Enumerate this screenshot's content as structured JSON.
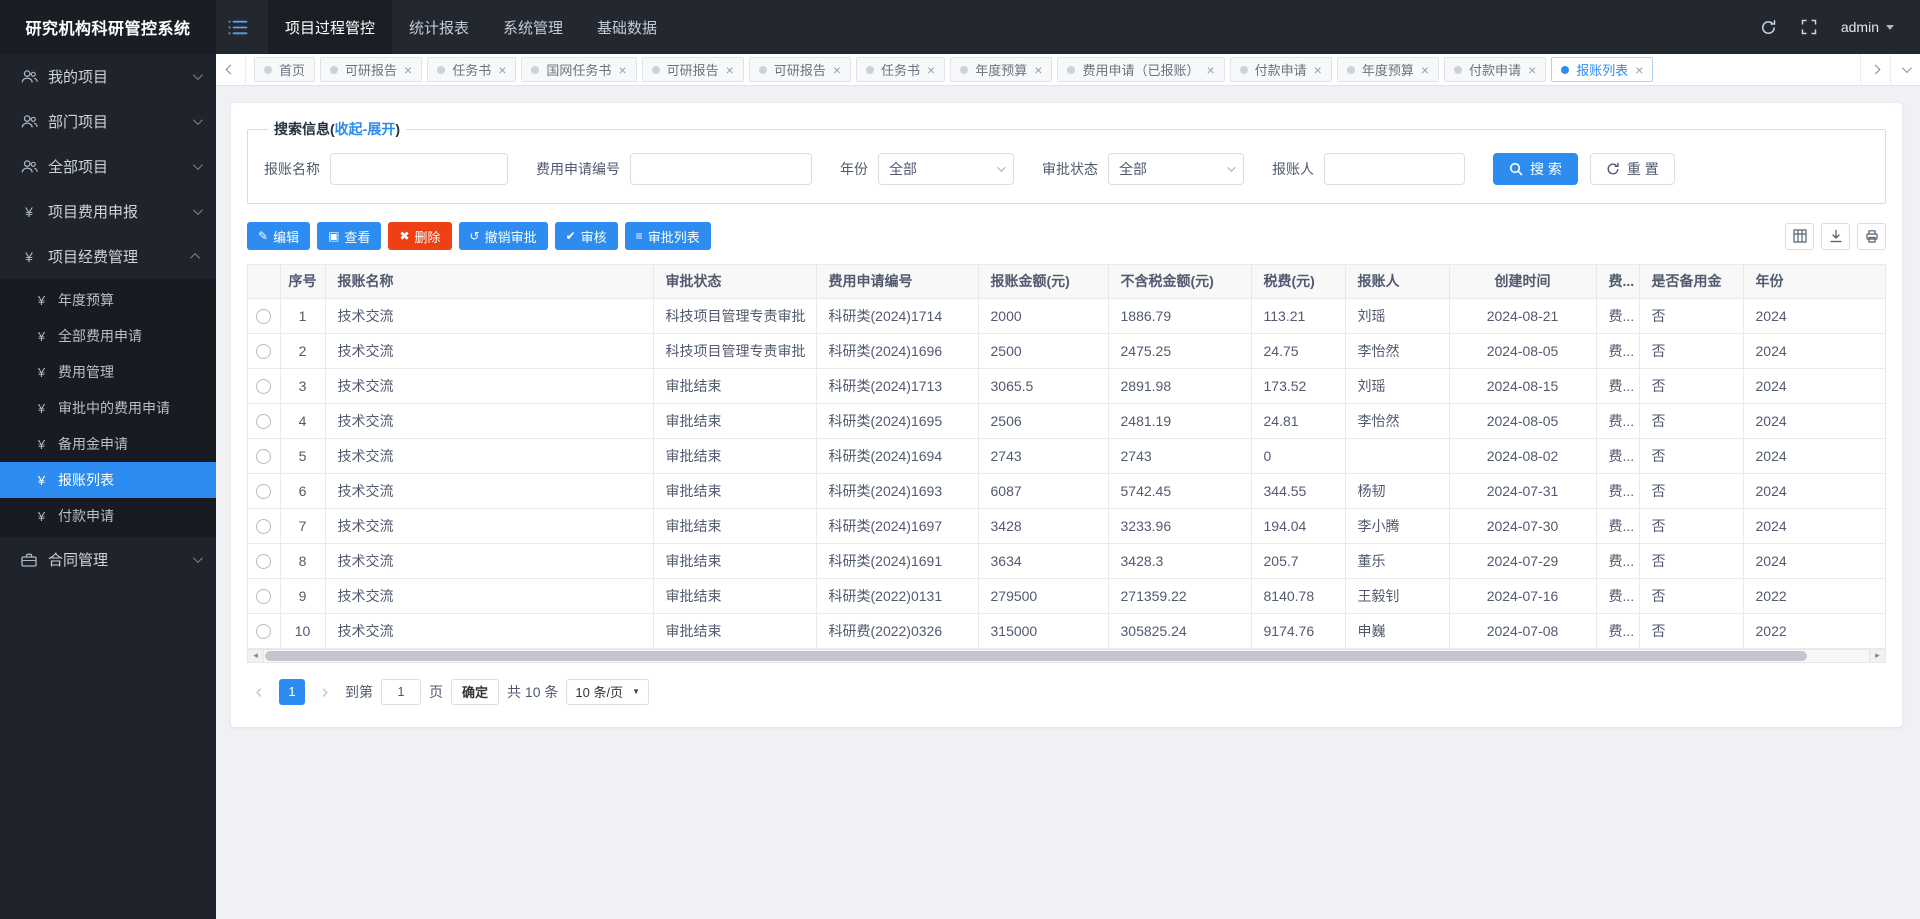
{
  "app_title": "研究机构科研管控系统",
  "accent_color": "#2d8cf0",
  "danger_color": "#ed4014",
  "header": {
    "nav_items": [
      {
        "label": "项目过程管控",
        "active": true,
        "name": "nav-project-process"
      },
      {
        "label": "统计报表",
        "name": "nav-statistics"
      },
      {
        "label": "系统管理",
        "name": "nav-system-mgmt"
      },
      {
        "label": "基础数据",
        "name": "nav-base-data"
      }
    ],
    "user_name": "admin"
  },
  "tag_nav": {
    "tabs": [
      {
        "label": "首页"
      },
      {
        "label": "可研报告",
        "closable": true
      },
      {
        "label": "任务书",
        "closable": true
      },
      {
        "label": "国网任务书",
        "closable": true
      },
      {
        "label": "可研报告",
        "closable": true
      },
      {
        "label": "可研报告",
        "closable": true
      },
      {
        "label": "任务书",
        "closable": true
      },
      {
        "label": "年度预算",
        "closable": true
      },
      {
        "label": "费用申请（已报账）",
        "closable": true
      },
      {
        "label": "付款申请",
        "closable": true
      },
      {
        "label": "年度预算",
        "closable": true
      },
      {
        "label": "付款申请",
        "closable": true
      },
      {
        "label": "报账列表",
        "closable": true,
        "active": true
      }
    ]
  },
  "sidebar": {
    "items": [
      {
        "label": "我的项目"
      },
      {
        "label": "部门项目"
      },
      {
        "label": "全部项目"
      },
      {
        "label": "项目费用申报"
      },
      {
        "label": "项目经费管理"
      },
      {
        "label": "合同管理"
      }
    ],
    "submenu_items": [
      {
        "label": "年度预算",
        "name": "sidebar-subitem-annual-budget"
      },
      {
        "label": "全部费用申请",
        "name": "sidebar-subitem-all-expense-apply"
      },
      {
        "label": "费用管理",
        "name": "sidebar-subitem-expense-mgmt"
      },
      {
        "label": "审批中的费用申请",
        "name": "sidebar-subitem-approving-expense"
      },
      {
        "label": "备用金申请",
        "name": "sidebar-subitem-reserve-fund"
      },
      {
        "label": "报账列表",
        "active": true,
        "name": "sidebar-subitem-reimburse-list"
      },
      {
        "label": "付款申请",
        "name": "sidebar-subitem-payment-apply"
      }
    ]
  },
  "search": {
    "legend_prefix": "搜索信息(",
    "legend_link": "收起-展开",
    "legend_suffix": ")",
    "name_label": "报账名称",
    "apply_no_label": "费用申请编号",
    "year_label": "年份",
    "year_value": "全部",
    "status_label": "审批状态",
    "status_value": "全部",
    "person_label": "报账人",
    "search_button": "搜 索",
    "reset_button": "重 置"
  },
  "toolbar": {
    "buttons": [
      {
        "label": "编辑",
        "type": "primary",
        "glyph": "✎",
        "name": "edit-button"
      },
      {
        "label": "查看",
        "type": "primary",
        "glyph": "▣",
        "name": "view-button"
      },
      {
        "label": "删除",
        "type": "danger",
        "glyph": "✖",
        "name": "delete-button"
      },
      {
        "label": "撤销审批",
        "type": "primary",
        "glyph": "↺",
        "name": "revoke-approval-button"
      },
      {
        "label": "审核",
        "type": "primary",
        "glyph": "✔",
        "name": "review-button"
      },
      {
        "label": "审批列表",
        "type": "primary",
        "glyph": "≡",
        "name": "approval-list-button"
      }
    ]
  },
  "table": {
    "columns": [
      "序号",
      "报账名称",
      "审批状态",
      "费用申请编号",
      "报账金额(元)",
      "不含税金额(元)",
      "税费(元)",
      "报账人",
      "创建时间",
      "费...",
      "是否备用金",
      "年份"
    ],
    "rows": [
      {
        "seq": "1",
        "name": "技术交流",
        "status": "科技项目管理专责审批",
        "apply_no": "科研类(2024)1714",
        "amount": "2000",
        "no_tax": "1886.79",
        "tax": "113.21",
        "person": "刘瑶",
        "created": "2024-08-21",
        "fee": "费...",
        "reserve": "否",
        "year": "2024"
      },
      {
        "seq": "2",
        "name": "技术交流",
        "status": "科技项目管理专责审批",
        "apply_no": "科研类(2024)1696",
        "amount": "2500",
        "no_tax": "2475.25",
        "tax": "24.75",
        "person": "李怡然",
        "created": "2024-08-05",
        "fee": "费...",
        "reserve": "否",
        "year": "2024"
      },
      {
        "seq": "3",
        "name": "技术交流",
        "status": "审批结束",
        "apply_no": "科研类(2024)1713",
        "amount": "3065.5",
        "no_tax": "2891.98",
        "tax": "173.52",
        "person": "刘瑶",
        "created": "2024-08-15",
        "fee": "费...",
        "reserve": "否",
        "year": "2024"
      },
      {
        "seq": "4",
        "name": "技术交流",
        "status": "审批结束",
        "apply_no": "科研类(2024)1695",
        "amount": "2506",
        "no_tax": "2481.19",
        "tax": "24.81",
        "person": "李怡然",
        "created": "2024-08-05",
        "fee": "费...",
        "reserve": "否",
        "year": "2024"
      },
      {
        "seq": "5",
        "name": "技术交流",
        "status": "审批结束",
        "apply_no": "科研类(2024)1694",
        "amount": "2743",
        "no_tax": "2743",
        "tax": "0",
        "person": "",
        "created": "2024-08-02",
        "fee": "费...",
        "reserve": "否",
        "year": "2024"
      },
      {
        "seq": "6",
        "name": "技术交流",
        "status": "审批结束",
        "apply_no": "科研类(2024)1693",
        "amount": "6087",
        "no_tax": "5742.45",
        "tax": "344.55",
        "person": "杨韧",
        "created": "2024-07-31",
        "fee": "费...",
        "reserve": "否",
        "year": "2024"
      },
      {
        "seq": "7",
        "name": "技术交流",
        "status": "审批结束",
        "apply_no": "科研类(2024)1697",
        "amount": "3428",
        "no_tax": "3233.96",
        "tax": "194.04",
        "person": "李小腾",
        "created": "2024-07-30",
        "fee": "费...",
        "reserve": "否",
        "year": "2024"
      },
      {
        "seq": "8",
        "name": "技术交流",
        "status": "审批结束",
        "apply_no": "科研类(2024)1691",
        "amount": "3634",
        "no_tax": "3428.3",
        "tax": "205.7",
        "person": "董乐",
        "created": "2024-07-29",
        "fee": "费...",
        "reserve": "否",
        "year": "2024"
      },
      {
        "seq": "9",
        "name": "技术交流",
        "status": "审批结束",
        "apply_no": "科研类(2022)0131",
        "amount": "279500",
        "no_tax": "271359.22",
        "tax": "8140.78",
        "person": "王毅钊",
        "created": "2024-07-16",
        "fee": "费...",
        "reserve": "否",
        "year": "2022"
      },
      {
        "seq": "10",
        "name": "技术交流",
        "status": "审批结束",
        "apply_no": "科研费(2022)0326",
        "amount": "315000",
        "no_tax": "305825.24",
        "tax": "9174.76",
        "person": "申巍",
        "created": "2024-07-08",
        "fee": "费...",
        "reserve": "否",
        "year": "2022"
      }
    ]
  },
  "pagination": {
    "current_page": "1",
    "goto_prefix": "到第",
    "goto_value": "1",
    "goto_suffix": "页",
    "confirm_button": "确定",
    "total_text": "共 10 条",
    "page_size": "10 条/页"
  }
}
